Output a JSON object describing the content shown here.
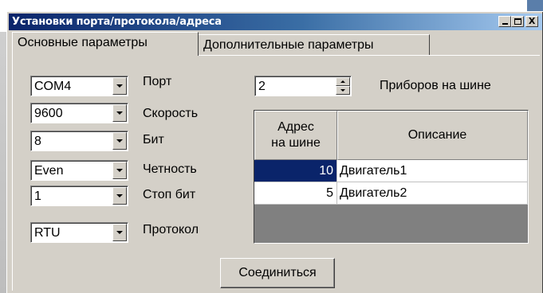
{
  "window": {
    "title": "Установки порта/протокола/адреса",
    "controls": {
      "minimize": "_",
      "maximize": "□",
      "close": "X"
    }
  },
  "tabs": [
    {
      "label": "Основные параметры",
      "active": true
    },
    {
      "label": "Дополнительные параметры",
      "active": false
    }
  ],
  "settings": {
    "port": {
      "value": "COM4",
      "label": "Порт"
    },
    "speed": {
      "value": "9600",
      "label": "Скорость"
    },
    "bits": {
      "value": "8",
      "label": "Бит"
    },
    "parity": {
      "value": "Even",
      "label": "Четность"
    },
    "stopbits": {
      "value": "1",
      "label": "Стоп бит"
    },
    "protocol": {
      "value": "RTU",
      "label": "Протокол"
    }
  },
  "devices_count": {
    "value": "2",
    "label": "Приборов на шине"
  },
  "devices_table": {
    "columns": {
      "address": "Адрес на шине",
      "description": "Описание"
    },
    "rows": [
      {
        "address": "10",
        "description": "Двигатель1",
        "selected": true
      },
      {
        "address": "5",
        "description": "Двигатель2",
        "selected": false
      }
    ]
  },
  "connect_button": "Соединиться",
  "colors": {
    "titlebar": "#0a246a",
    "face": "#d4d0c8",
    "selection": "#0a246a"
  }
}
